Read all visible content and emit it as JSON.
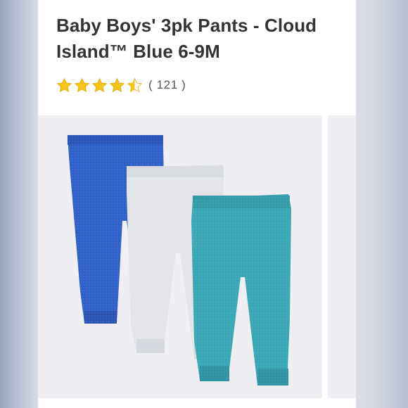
{
  "product": {
    "title": "Baby Boys' 3pk Pants - Cloud Island™ Blue 6-9M",
    "rating": {
      "value": 4.5,
      "max": 5,
      "review_count_text": "( 121 )",
      "star_color": "#f5c518"
    },
    "image": {
      "description": "three-pack-pants",
      "colors": [
        "#2f5fc9",
        "#e2e4e8",
        "#3aa7b6"
      ]
    }
  }
}
